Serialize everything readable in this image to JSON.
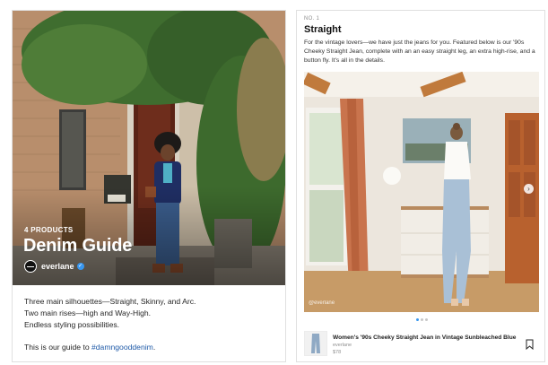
{
  "guide": {
    "product_count": "4 PRODUCTS",
    "title": "Denim Guide",
    "author": "everlane",
    "description_lines": [
      "Three main silhouettes—Straight, Skinny, and Arc.",
      "Two main rises—high and Way-High.",
      "Endless styling possibilities."
    ],
    "guide_text": "This is our guide to ",
    "hashtag": "#damngooddenim",
    "guide_text_end": "."
  },
  "section": {
    "number": "NO. 1",
    "title": "Straight",
    "body": "For the vintage lovers—we have just the jeans for you. Featured below is our '90s Cheeky Straight Jean, complete with an an easy straight leg, an extra high-rise, and a button fly. It's all in the details.",
    "photo_credit": "@everlane"
  },
  "carousel": {
    "count": 3,
    "active_index": 0
  },
  "product": {
    "name": "Women's '90s Cheeky Straight Jean in Vintage Sunbleached Blue",
    "brand": "everlane",
    "price": "$78"
  },
  "icons": {
    "verified": "verified-badge-icon",
    "next": "chevron-right-icon",
    "save": "bookmark-icon"
  },
  "colors": {
    "accent": "#3897f0",
    "hashtag": "#1f5aa8"
  }
}
